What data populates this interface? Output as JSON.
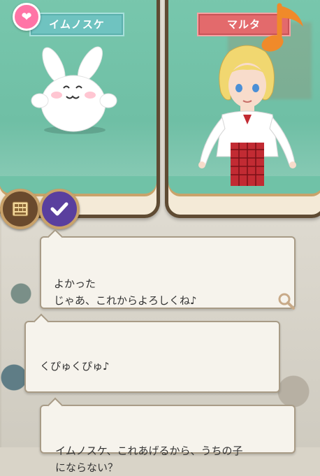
{
  "left_panel": {
    "name": "イムノスケ",
    "name_tag_color": "#6fc3c0",
    "badge_icon": "heart-icon"
  },
  "right_panel": {
    "name": "マルタ",
    "name_tag_color": "#e36a6c",
    "status_icon": "music-note-icon"
  },
  "buttons": {
    "keyboard_icon": "keyboard-icon",
    "check_icon": "check-icon"
  },
  "messages": [
    {
      "text": "よかった\nじゃあ、これからよろしくね♪"
    },
    {
      "text": "くぴゅくぴゅ♪"
    },
    {
      "text": "イムノスケ、これあげるから、うちの子\nにならない？"
    }
  ]
}
